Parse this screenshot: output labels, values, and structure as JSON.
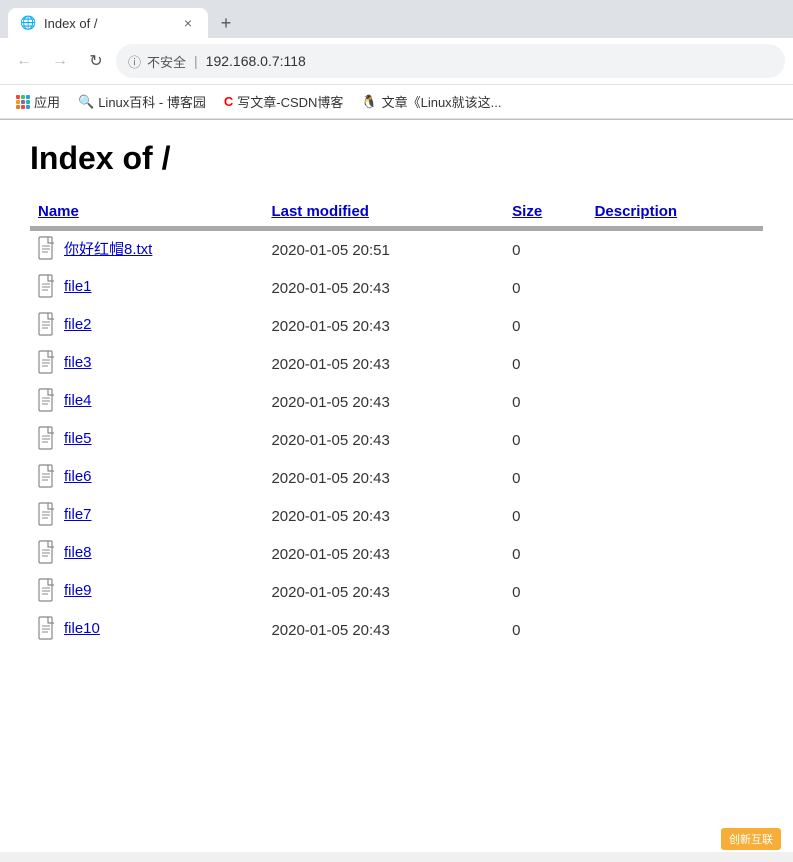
{
  "browser": {
    "tab": {
      "title": "Index of /",
      "favicon_symbol": "🌐"
    },
    "new_tab_symbol": "+",
    "close_tab_symbol": "×",
    "nav": {
      "back_symbol": "←",
      "forward_symbol": "→",
      "refresh_symbol": "↻",
      "security_label": "不安全",
      "separator": "|",
      "url": "192.168.0.7:118"
    },
    "bookmarks": [
      {
        "label": "应用",
        "type": "apps"
      },
      {
        "label": "Linux百科 - 博客园"
      },
      {
        "label": "写文章-CSDN博客"
      },
      {
        "label": "文章《Linux就该这..."
      }
    ]
  },
  "page": {
    "title": "Index of /",
    "table": {
      "headers": [
        "Name",
        "Last modified",
        "Size",
        "Description"
      ],
      "rows": [
        {
          "name": "你好红帽8.txt",
          "modified": "2020-01-05 20:51",
          "size": "0"
        },
        {
          "name": "file1",
          "modified": "2020-01-05 20:43",
          "size": "0"
        },
        {
          "name": "file2",
          "modified": "2020-01-05 20:43",
          "size": "0"
        },
        {
          "name": "file3",
          "modified": "2020-01-05 20:43",
          "size": "0"
        },
        {
          "name": "file4",
          "modified": "2020-01-05 20:43",
          "size": "0"
        },
        {
          "name": "file5",
          "modified": "2020-01-05 20:43",
          "size": "0"
        },
        {
          "name": "file6",
          "modified": "2020-01-05 20:43",
          "size": "0"
        },
        {
          "name": "file7",
          "modified": "2020-01-05 20:43",
          "size": "0"
        },
        {
          "name": "file8",
          "modified": "2020-01-05 20:43",
          "size": "0"
        },
        {
          "name": "file9",
          "modified": "2020-01-05 20:43",
          "size": "0"
        },
        {
          "name": "file10",
          "modified": "2020-01-05 20:43",
          "size": "0"
        }
      ]
    }
  },
  "watermark": {
    "label": "创新互联"
  }
}
